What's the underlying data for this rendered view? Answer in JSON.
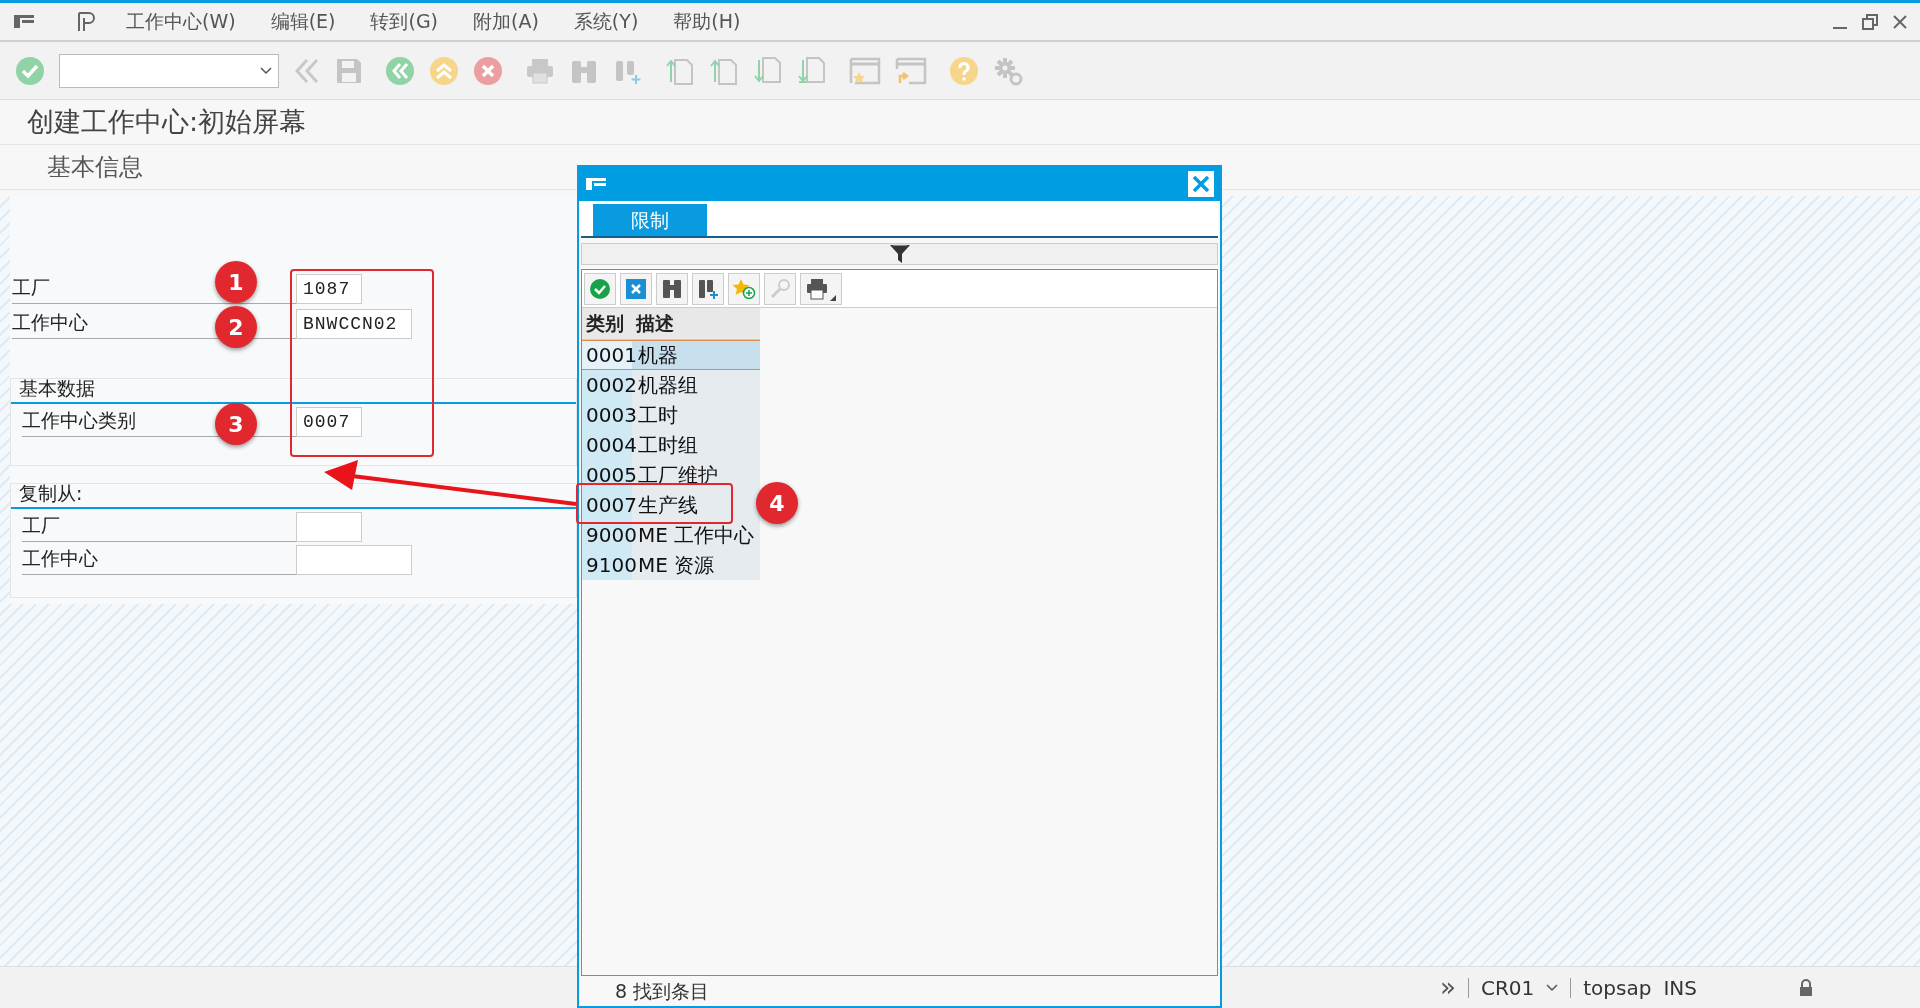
{
  "menu": [
    {
      "label": "工作中心(W)"
    },
    {
      "label": "编辑(E)"
    },
    {
      "label": "转到(G)"
    },
    {
      "label": "附加(A)"
    },
    {
      "label": "系统(Y)"
    },
    {
      "label": "帮助(H)"
    }
  ],
  "page_title": "创建工作中心:初始屏幕",
  "section_tab": "基本信息",
  "fields": [
    {
      "label": "工厂",
      "value": "1087"
    },
    {
      "label": "工作中心",
      "value": "BNWCCN02"
    }
  ],
  "groups": [
    {
      "title": "基本数据",
      "fields": [
        {
          "label": "工作中心类别",
          "value": "0007"
        }
      ]
    },
    {
      "title": "复制从:",
      "fields": [
        {
          "label": "工厂"
        },
        {
          "label": "工作中心"
        }
      ]
    }
  ],
  "popup": {
    "tabs": [
      {
        "label": "限制",
        "selected": true
      }
    ],
    "columns": [
      "类别",
      "描述"
    ],
    "rows": [
      {
        "code": "0001",
        "description": "机器",
        "selected": true
      },
      {
        "code": "0002",
        "description": "机器组",
        "selected": false
      },
      {
        "code": "0003",
        "description": "工时",
        "selected": false
      },
      {
        "code": "0004",
        "description": "工时组",
        "selected": false
      },
      {
        "code": "0005",
        "description": "工厂维护",
        "selected": false
      },
      {
        "code": "0007",
        "description": "生产线",
        "selected": false
      },
      {
        "code": "9000",
        "description": "ME 工作中心",
        "selected": false
      },
      {
        "code": "9100",
        "description": "ME 资源",
        "selected": false
      }
    ],
    "status": "8 找到条目"
  },
  "status_bar": {
    "expand": "»",
    "system": "CR01",
    "user": "topsap",
    "mode": "INS"
  },
  "callouts": [
    {
      "label": "1"
    },
    {
      "label": "2"
    },
    {
      "label": "3"
    },
    {
      "label": "4"
    }
  ]
}
